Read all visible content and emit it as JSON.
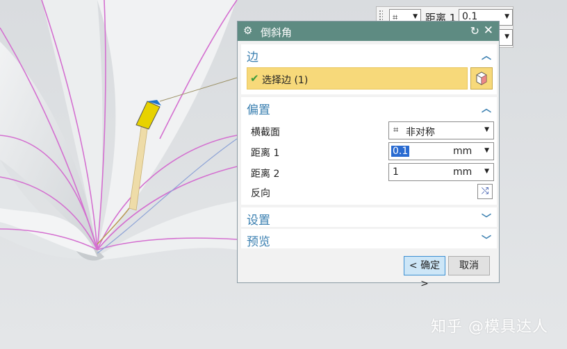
{
  "toolbar": {
    "section_icon": "edge-select-icon",
    "distance_label": "距离 1",
    "distance_value": "0.1"
  },
  "dialog": {
    "title": "倒斜角",
    "edge": {
      "header": "边",
      "select_label": "选择边 (1)"
    },
    "offset": {
      "header": "偏置",
      "cross_section_label": "横截面",
      "cross_section_value": "非对称",
      "distance1_label": "距离 1",
      "distance1_value": "0.1",
      "distance1_unit": "mm",
      "distance2_label": "距离 2",
      "distance2_value": "1",
      "distance2_unit": "mm",
      "reverse_label": "反向"
    },
    "settings_header": "设置",
    "preview_header": "预览",
    "ok_label": "< 确定 >",
    "cancel_label": "取消"
  },
  "watermark": "知乎 @模具达人",
  "colors": {
    "titlebar": "#5e8b82",
    "section_header_text": "#3a7fb0",
    "selection_highlight": "#f7d97a",
    "curve_pink": "#d46fd0"
  }
}
